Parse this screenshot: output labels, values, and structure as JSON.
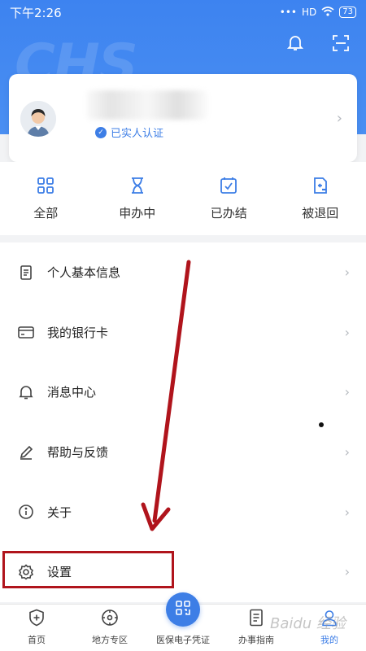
{
  "status_bar": {
    "time": "下午2:26",
    "signal": "HD",
    "battery": "73"
  },
  "header": {
    "watermark": "CHS"
  },
  "profile": {
    "verified_text": "已实人认证"
  },
  "quick_actions": [
    {
      "label": "全部",
      "icon": "grid-icon"
    },
    {
      "label": "申办中",
      "icon": "hourglass-icon"
    },
    {
      "label": "已办结",
      "icon": "checkbox-icon"
    },
    {
      "label": "被退回",
      "icon": "returned-doc-icon"
    }
  ],
  "menu": [
    {
      "label": "个人基本信息",
      "icon": "document-icon"
    },
    {
      "label": "我的银行卡",
      "icon": "card-icon"
    },
    {
      "label": "消息中心",
      "icon": "bell-icon"
    },
    {
      "label": "帮助与反馈",
      "icon": "pen-icon"
    },
    {
      "label": "关于",
      "icon": "info-icon"
    },
    {
      "label": "设置",
      "icon": "gear-icon"
    }
  ],
  "tabbar": [
    {
      "label": "首页",
      "active": false
    },
    {
      "label": "地方专区",
      "active": false
    },
    {
      "label": "医保电子凭证",
      "active": false
    },
    {
      "label": "办事指南",
      "active": false
    },
    {
      "label": "我的",
      "active": true
    }
  ],
  "colors": {
    "primary": "#3d7ee6",
    "annotation": "#b0141c"
  },
  "watermark_text": "Baidu 经验"
}
